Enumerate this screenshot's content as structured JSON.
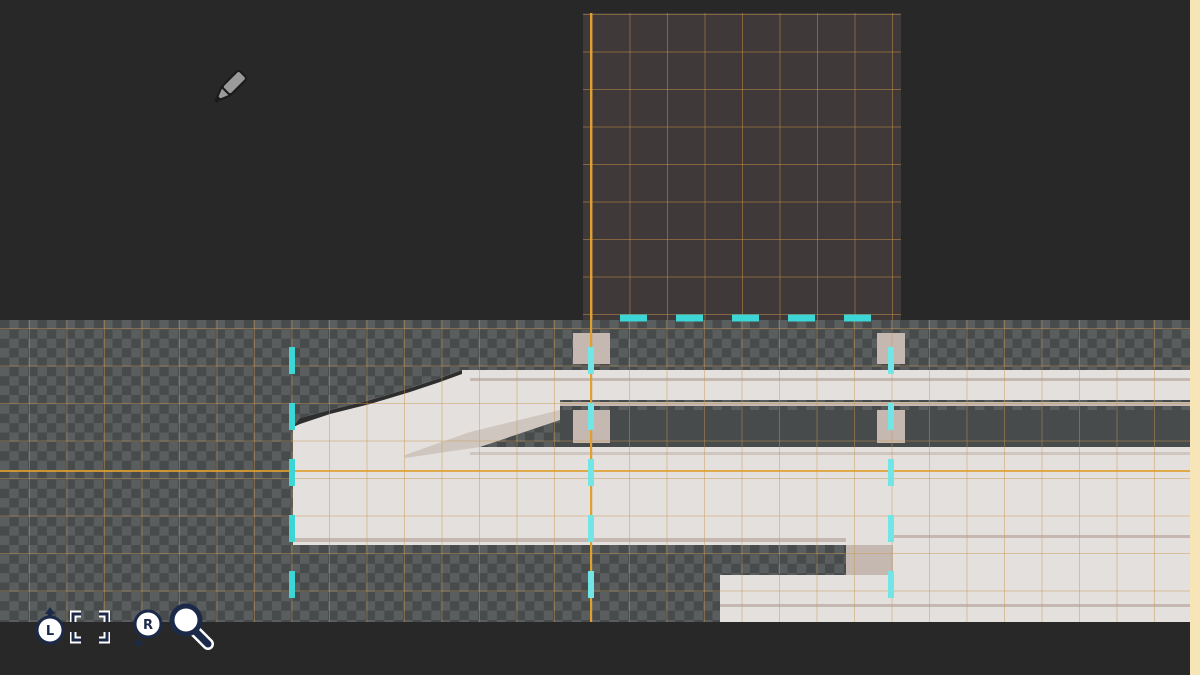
{
  "editor": {
    "tool": "pen-icon",
    "colors": {
      "background": "#282828",
      "canvas_upper": "#3f3939",
      "grid_line": "#be8c46",
      "guide_line": "#e0a030",
      "selection_dash": "#3cd6d6",
      "pixel_fill": "#e4e0dd",
      "pixel_shadow": "#c4b8b0",
      "right_strip": "#f7e5b8"
    }
  },
  "controls": {
    "l_button": "L",
    "fit_icon": "fit-screen-icon",
    "r_button": "R",
    "zoom_icon": "zoom-icon"
  }
}
